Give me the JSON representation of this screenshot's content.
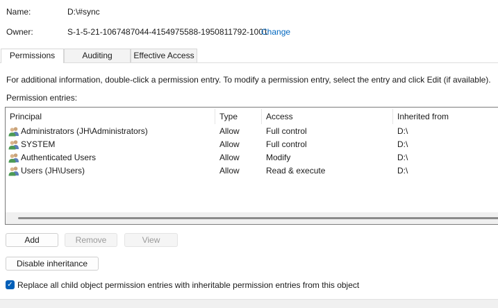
{
  "object": {
    "name_label": "Name:",
    "name_value": "D:\\#sync",
    "owner_label": "Owner:",
    "owner_value": "S-1-5-21-1067487044-4154975588-1950811792-1001",
    "change_link": "Change"
  },
  "tabs": [
    {
      "label": "Permissions",
      "active": true
    },
    {
      "label": "Auditing",
      "active": false
    },
    {
      "label": "Effective Access",
      "active": false
    }
  ],
  "info_text": "For additional information, double-click a permission entry. To modify a permission entry, select the entry and click Edit (if available).",
  "entries_label": "Permission entries:",
  "columns": [
    "Principal",
    "Type",
    "Access",
    "Inherited from"
  ],
  "rows": [
    {
      "principal": "Administrators (JH\\Administrators)",
      "type": "Allow",
      "access": "Full control",
      "inherited": "D:\\"
    },
    {
      "principal": "SYSTEM",
      "type": "Allow",
      "access": "Full control",
      "inherited": "D:\\"
    },
    {
      "principal": "Authenticated Users",
      "type": "Allow",
      "access": "Modify",
      "inherited": "D:\\"
    },
    {
      "principal": "Users (JH\\Users)",
      "type": "Allow",
      "access": "Read & execute",
      "inherited": "D:\\"
    }
  ],
  "buttons": {
    "add": "Add",
    "remove": "Remove",
    "view": "View",
    "disable_inheritance": "Disable inheritance"
  },
  "replace_checkbox": {
    "label": "Replace all child object permission entries with inheritable permission entries from this object",
    "checked": true
  },
  "icons": {
    "principal": "users-group-icon",
    "checkbox": "checkmark-icon"
  }
}
